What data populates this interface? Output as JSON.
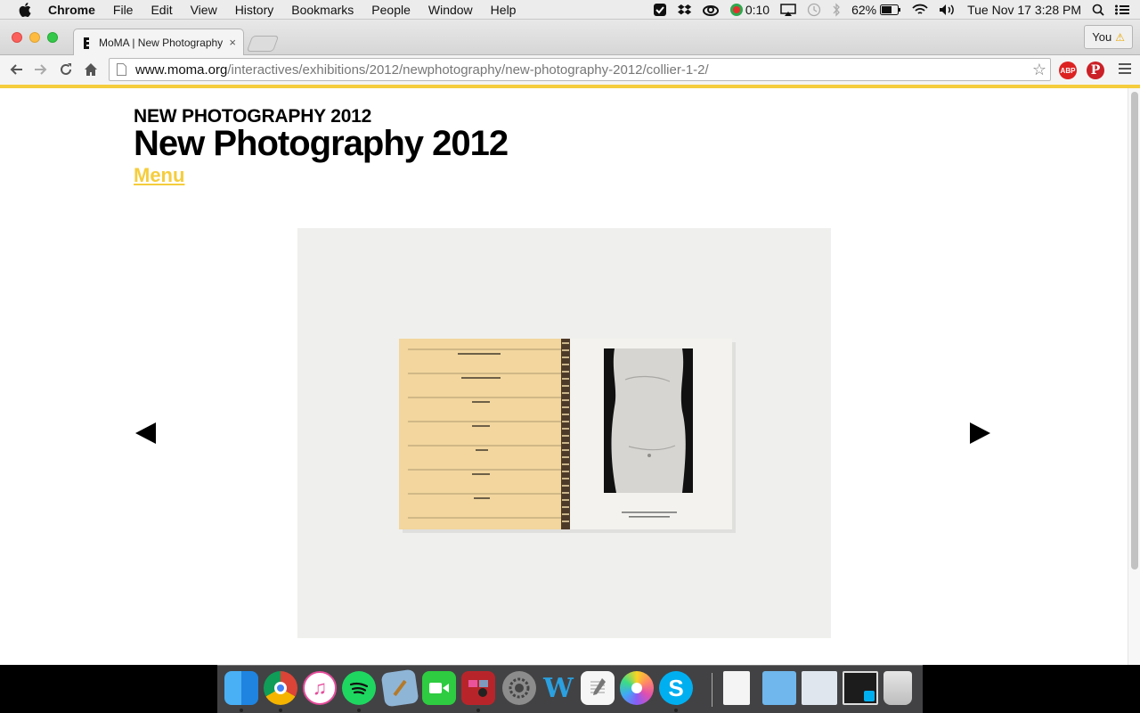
{
  "menubar": {
    "app_name": "Chrome",
    "items": [
      "File",
      "Edit",
      "View",
      "History",
      "Bookmarks",
      "People",
      "Window",
      "Help"
    ],
    "timer": "0:10",
    "battery": "62%",
    "datetime": "Tue Nov 17  3:28 PM"
  },
  "browser": {
    "tab_title": "MoMA | New Photography",
    "tab_close": "×",
    "profile": "You",
    "profile_warning": "⚠",
    "url_host": "www.moma.org",
    "url_path": "/interactives/exhibitions/2012/newphotography/new-photography-2012/collier-1-2/",
    "bookmark_star": "☆",
    "ext_abp": "ABP",
    "ext_pinterest": "P"
  },
  "page": {
    "kicker": "NEW PHOTOGRAPHY 2012",
    "title": "New Photography 2012",
    "menu_link": "Menu"
  },
  "colors": {
    "accent_yellow": "#f5cd3d",
    "page_bg": "#ffffff",
    "photo_bg": "#efefed"
  },
  "dock": {
    "icons": [
      "finder-icon",
      "chrome-icon",
      "itunes-icon",
      "spotify-icon",
      "preview-icon",
      "facetime-icon",
      "photo-booth-icon",
      "system-preferences-icon",
      "word-icon",
      "textedit-icon",
      "photos-icon",
      "skype-icon",
      "document-icon",
      "folder-icon",
      "window-icon",
      "screenshot-icon",
      "trash-icon"
    ]
  }
}
